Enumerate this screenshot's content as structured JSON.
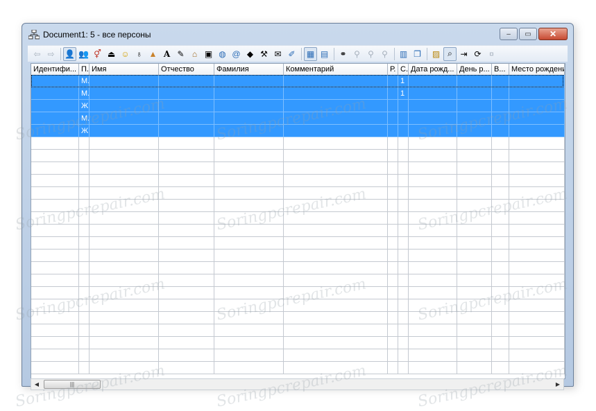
{
  "window": {
    "title": "Document1: 5 - все персоны",
    "minimize": "–",
    "maximize": "▭",
    "close": "✕"
  },
  "toolbar": {
    "icons": [
      "back-arrow-icon",
      "forward-arrow-icon",
      "person-icon",
      "persons-icon",
      "gender-icon",
      "family-tree-icon",
      "smiley-icon",
      "apple-icon",
      "pyramid-icon",
      "font-a-icon",
      "pencil-icon",
      "house-icon",
      "photo-icon",
      "globe-icon",
      "email-at-icon",
      "graduation-cap-icon",
      "hammer-icon",
      "chat-icon",
      "edit-icon",
      "grid-icon",
      "tree-view-icon",
      "binoculars-icon",
      "filter-add-icon",
      "filter-plus-icon",
      "filter-minus-icon",
      "columns-icon",
      "copy-icon",
      "properties-icon",
      "search-document-icon",
      "export-icon",
      "refresh-icon",
      "close-small-icon"
    ]
  },
  "table": {
    "columns": [
      "Идентифи...",
      "П.",
      "Имя",
      "Отчество",
      "Фамилия",
      "Комментарий",
      "Р.",
      "С.",
      "Дата рожд...",
      "День р...",
      "В...",
      "Место рождени"
    ],
    "rows": [
      [
        "",
        "М.",
        "",
        "",
        "",
        "",
        "",
        "1",
        "",
        "",
        "",
        ""
      ],
      [
        "",
        "М.",
        "",
        "",
        "",
        "",
        "",
        "1",
        "",
        "",
        "",
        ""
      ],
      [
        "",
        "Ж",
        "",
        "",
        "",
        "",
        "",
        "",
        "",
        "",
        "",
        ""
      ],
      [
        "",
        "М.",
        "",
        "",
        "",
        "",
        "",
        "",
        "",
        "",
        "",
        ""
      ],
      [
        "",
        "Ж",
        "",
        "",
        "",
        "",
        "",
        "",
        "",
        "",
        "",
        ""
      ]
    ]
  },
  "scrollbar": {
    "left_arrow": "◀",
    "right_arrow": "▶",
    "thumb_grip": "|||"
  },
  "watermark": "Soringpcrepair.com",
  "colors": {
    "selection": "#3399ff",
    "title_bg": "#c9d9ec",
    "close_btn": "#c74a32"
  }
}
